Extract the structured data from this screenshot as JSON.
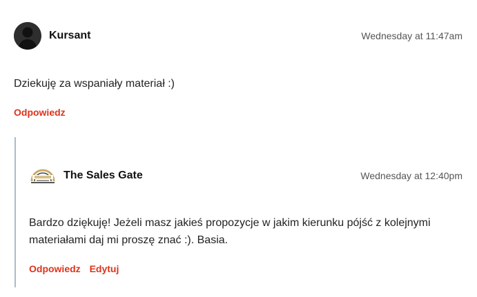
{
  "comment": {
    "author": "Kursant",
    "timestamp": "Wednesday at 11:47am",
    "text": "Dziekuję za wspaniały materiał :)",
    "reply_label": "Odpowiedz"
  },
  "reply": {
    "author": "The Sales Gate",
    "timestamp": "Wednesday at 12:40pm",
    "text": "Bardzo dziękuję! Jeżeli masz jakieś propozycje w jakim kierunku pójść z kolejnymi materiałami daj mi proszę znać :). Basia.",
    "reply_label": "Odpowiedz",
    "edit_label": "Edytuj"
  },
  "colors": {
    "accent": "#e0321b",
    "thread_line": "#a9bcc8"
  },
  "icons": {
    "avatar_default": "user-silhouette-icon",
    "reply_avatar": "the-sales-gate-logo"
  }
}
